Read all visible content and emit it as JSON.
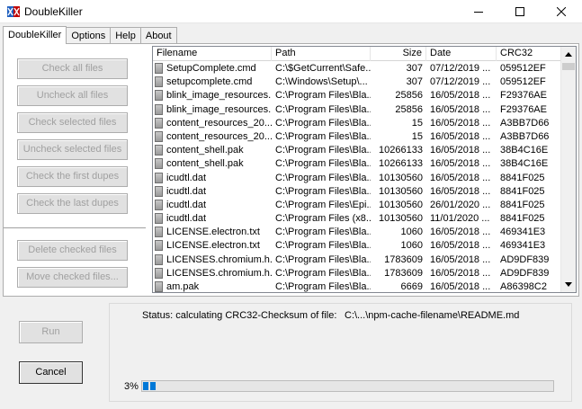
{
  "window": {
    "title": "DoubleKiller",
    "brand_color_left": "#1f5fbf",
    "brand_color_right": "#c00000"
  },
  "tabs": [
    {
      "label": "DoubleKiller",
      "active": true
    },
    {
      "label": "Options",
      "active": false
    },
    {
      "label": "Help",
      "active": false
    },
    {
      "label": "About",
      "active": false
    }
  ],
  "actions": {
    "check_all": "Check all files",
    "uncheck_all": "Uncheck all files",
    "check_selected": "Check selected files",
    "uncheck_selected": "Uncheck selected files",
    "check_first_dupes": "Check the first dupes",
    "check_last_dupes": "Check the last dupes",
    "delete_checked": "Delete checked files",
    "move_checked": "Move checked files..."
  },
  "list": {
    "columns": [
      "Filename",
      "Path",
      "Size",
      "Date",
      "CRC32"
    ],
    "rows": [
      [
        "SetupComplete.cmd",
        "C:\\$GetCurrent\\Safe...",
        "307",
        "07/12/2019 ...",
        "059512EF"
      ],
      [
        "setupcomplete.cmd",
        "C:\\Windows\\Setup\\...",
        "307",
        "07/12/2019 ...",
        "059512EF"
      ],
      [
        "blink_image_resources...",
        "C:\\Program Files\\Bla...",
        "25856",
        "16/05/2018 ...",
        "F29376AE"
      ],
      [
        "blink_image_resources...",
        "C:\\Program Files\\Bla...",
        "25856",
        "16/05/2018 ...",
        "F29376AE"
      ],
      [
        "content_resources_20...",
        "C:\\Program Files\\Bla...",
        "15",
        "16/05/2018 ...",
        "A3BB7D66"
      ],
      [
        "content_resources_20...",
        "C:\\Program Files\\Bla...",
        "15",
        "16/05/2018 ...",
        "A3BB7D66"
      ],
      [
        "content_shell.pak",
        "C:\\Program Files\\Bla...",
        "10266133",
        "16/05/2018 ...",
        "38B4C16E"
      ],
      [
        "content_shell.pak",
        "C:\\Program Files\\Bla...",
        "10266133",
        "16/05/2018 ...",
        "38B4C16E"
      ],
      [
        "icudtl.dat",
        "C:\\Program Files\\Bla...",
        "10130560",
        "16/05/2018 ...",
        "8841F025"
      ],
      [
        "icudtl.dat",
        "C:\\Program Files\\Bla...",
        "10130560",
        "16/05/2018 ...",
        "8841F025"
      ],
      [
        "icudtl.dat",
        "C:\\Program Files\\Epi...",
        "10130560",
        "26/01/2020 ...",
        "8841F025"
      ],
      [
        "icudtl.dat",
        "C:\\Program Files (x8...",
        "10130560",
        "11/01/2020 ...",
        "8841F025"
      ],
      [
        "LICENSE.electron.txt",
        "C:\\Program Files\\Bla...",
        "1060",
        "16/05/2018 ...",
        "469341E3"
      ],
      [
        "LICENSE.electron.txt",
        "C:\\Program Files\\Bla...",
        "1060",
        "16/05/2018 ...",
        "469341E3"
      ],
      [
        "LICENSES.chromium.h...",
        "C:\\Program Files\\Bla...",
        "1783609",
        "16/05/2018 ...",
        "AD9DF839"
      ],
      [
        "LICENSES.chromium.h...",
        "C:\\Program Files\\Bla...",
        "1783609",
        "16/05/2018 ...",
        "AD9DF839"
      ],
      [
        "am.pak",
        "C:\\Program Files\\Bla...",
        "6669",
        "16/05/2018 ...",
        "A86398C2"
      ]
    ]
  },
  "run_button": "Run",
  "cancel_button": "Cancel",
  "status": {
    "label": "Status: calculating CRC32-Checksum of file:",
    "path": "C:\\...\\npm-cache-filename\\README.md"
  },
  "progress": {
    "percent_text": "3%",
    "percent": 3,
    "color": "#0078d7"
  }
}
